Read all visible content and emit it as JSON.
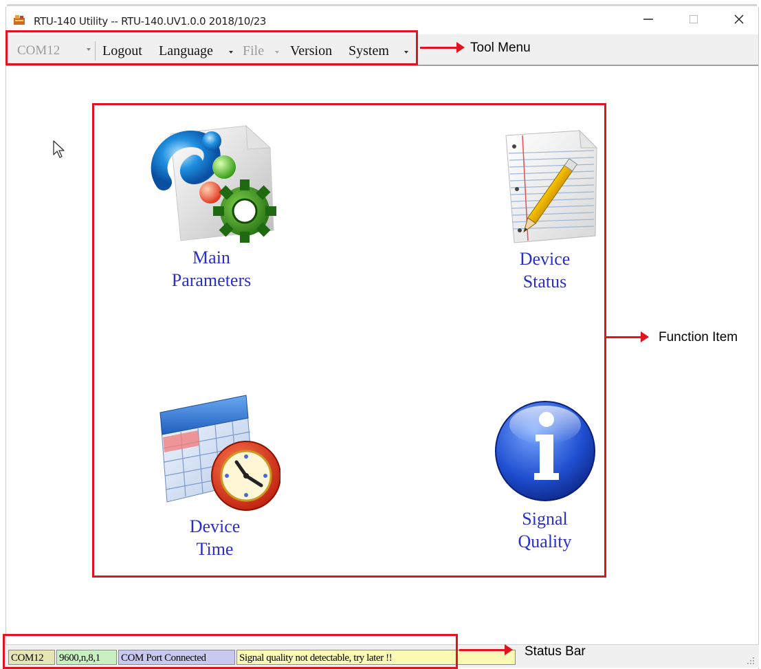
{
  "window": {
    "title": "RTU-140 Utility -- RTU-140.UV1.0.0 2018/10/23",
    "minimize_glyph": "—",
    "maximize_glyph": "☐",
    "close_glyph": "✕"
  },
  "toolbar": {
    "port_value": "COM12",
    "logout": "Logout",
    "language": "Language",
    "file": "File",
    "version": "Version",
    "system": "System"
  },
  "functions": {
    "main_parameters": {
      "line1": "Main",
      "line2": "Parameters",
      "icon": "main-parameters-icon"
    },
    "device_status": {
      "line1": "Device",
      "line2": "Status",
      "icon": "notepad-pencil-icon"
    },
    "device_time": {
      "line1": "Device",
      "line2": "Time",
      "icon": "calendar-clock-icon"
    },
    "signal_quality": {
      "line1": "Signal",
      "line2": "Quality",
      "icon": "info-icon"
    }
  },
  "statusbar": {
    "port": "COM12",
    "settings": "9600,n,8,1",
    "connection": "COM Port Connected",
    "signal": "Signal quality not detectable, try later !!"
  },
  "annotations": {
    "tool_menu": "Tool Menu",
    "function_item": "Function Item",
    "status_bar": "Status Bar"
  },
  "colors": {
    "annotation_red": "#e0141e",
    "function_label_blue": "#2a2fc9",
    "status_port_bg": "#e6e6b4",
    "status_settings_bg": "#c8f0c0",
    "status_connection_bg": "#c8c8f0",
    "status_signal_bg": "#fafab4"
  }
}
